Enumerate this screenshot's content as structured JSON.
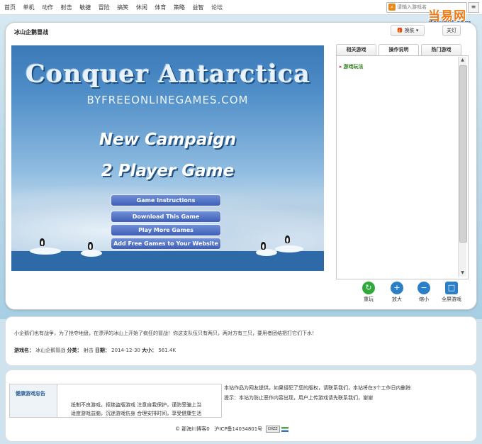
{
  "nav": {
    "links": [
      "首页",
      "单机",
      "动作",
      "射击",
      "敏捷",
      "冒险",
      "搞笑",
      "休闲",
      "体育",
      "策略",
      "益智",
      "论坛"
    ],
    "search_placeholder": "请输入游戏名",
    "menu_icon": "≡"
  },
  "logo": {
    "cn": "当易网",
    "en": "downyi.com"
  },
  "page": {
    "game_title": "冰山企鹅冒战",
    "skin_label": "换肤",
    "lights_label": "关灯"
  },
  "game": {
    "title": "Conquer Antarctica",
    "subtitle": "BYFREEONLINEGAMES.COM",
    "line1": "New Campaign",
    "line2": "2 Player Game",
    "buttons": [
      "Game Instructions",
      "Download This Game",
      "Play More Games",
      "Add Free Games to Your Website"
    ]
  },
  "tabs": {
    "items": [
      "相关游戏",
      "操作说明",
      "热门游戏"
    ],
    "active_index": 1,
    "content": "游戏玩法"
  },
  "controls": [
    {
      "label": "重玩",
      "icon": "refresh-icon",
      "color": "#2fa83a",
      "glyph": "↻"
    },
    {
      "label": "放大",
      "icon": "zoom-in-icon",
      "color": "#2b7fc6",
      "glyph": "+"
    },
    {
      "label": "缩小",
      "icon": "zoom-out-icon",
      "color": "#2b7fc6",
      "glyph": "−"
    },
    {
      "label": "全屏游戏",
      "icon": "fullscreen-icon",
      "color": "#2b7fc6",
      "glyph": "□"
    }
  ],
  "info": {
    "description": "小企鹅们也有战争，为了抢夺地盘，在漂浮的冰山上开始了疯狂的冒战！你这支队伍只有两只，两对方有三只，要用者团结把打它们下水！",
    "name_label": "游戏名：",
    "name_value": "冰山企鹅冒战",
    "category_label": "分类：",
    "category_value": "射击",
    "date_label": "日期：",
    "date_value": "2014-12-30",
    "size_label": "大小：",
    "size_value": "561.4K"
  },
  "footer": {
    "health_title": "健康游戏忠告",
    "health_line1": "抵制不良游戏，拒绝盗版游戏 注意自我保护，谨防受骗上当",
    "health_line2": "适度游戏益脑，沉迷游戏伤身 合理安排时间，享受健康生活",
    "notice_line1": "本站作品为网友提供，如果侵犯了您的版权，请联系我们，本站将在3个工作日内删除",
    "notice_line2": "提示：本站为防止恶作内容出现，用户上传游戏请先联系我们，谢谢",
    "copyright": "© 那海川博客0",
    "icp": "沪ICP备14034801号",
    "cnzz": "CNZZ"
  }
}
